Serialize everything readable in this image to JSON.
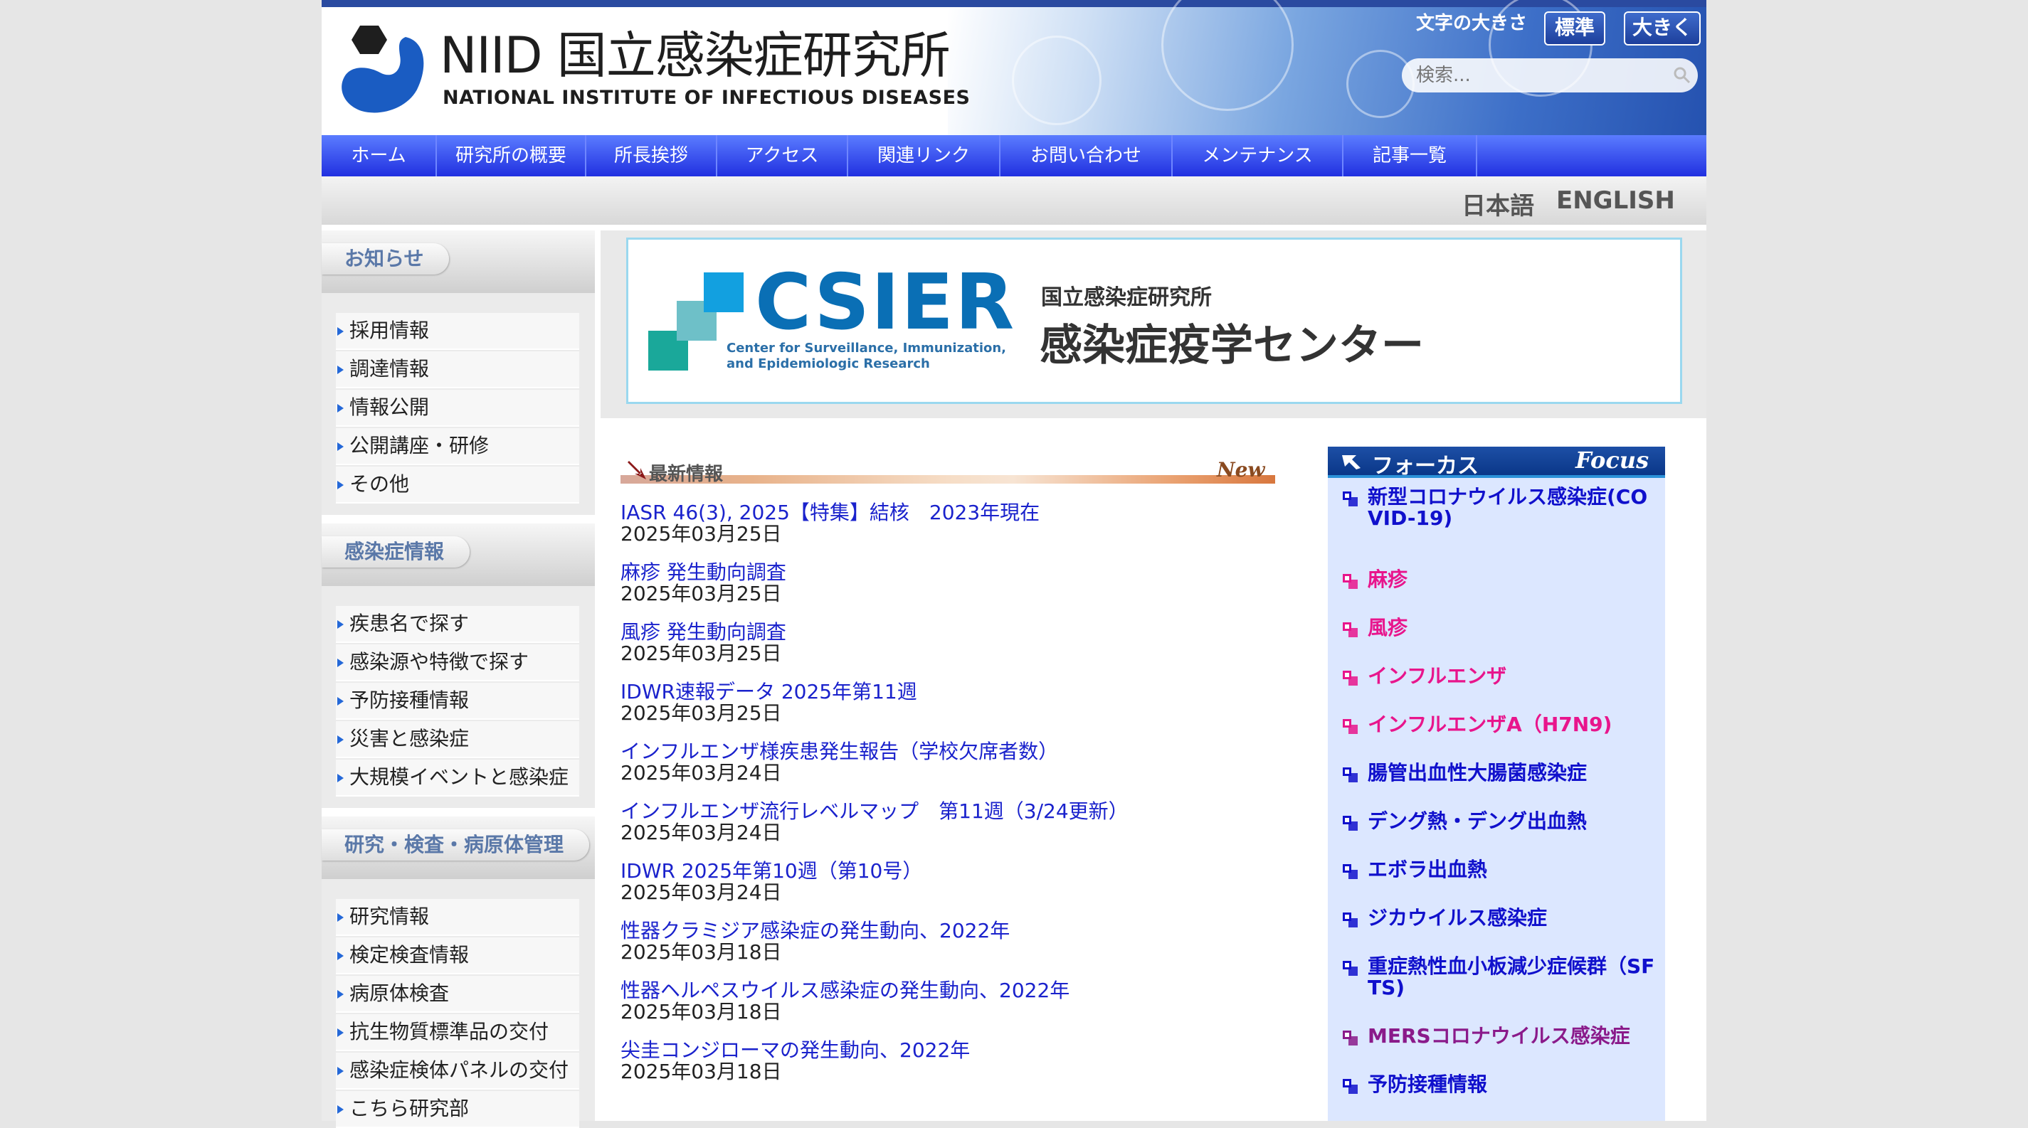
{
  "header": {
    "logo_jp": "NIID 国立感染症研究所",
    "logo_en": "NATIONAL INSTITUTE OF INFECTIOUS DISEASES",
    "font_size_label": "文字の大きさ",
    "font_size_standard": "標準",
    "font_size_large": "大きく",
    "search_placeholder": "検索..."
  },
  "nav": {
    "items": [
      "ホーム",
      "研究所の概要",
      "所長挨拶",
      "アクセス",
      "関連リンク",
      "お問い合わせ",
      "メンテナンス",
      "記事一覧"
    ]
  },
  "lang": {
    "jp": "日本語",
    "en": "ENGLISH"
  },
  "sidebar": {
    "sections": [
      {
        "title": "お知らせ",
        "items": [
          "採用情報",
          "調達情報",
          "情報公開",
          "公開講座・研修",
          "その他"
        ]
      },
      {
        "title": "感染症情報",
        "items": [
          "疾患名で探す",
          "感染源や特徴で探す",
          "予防接種情報",
          "災害と感染症",
          "大規模イベントと感染症"
        ]
      },
      {
        "title": "研究・検査・病原体管理",
        "items": [
          "研究情報",
          "検定検査情報",
          "病原体検査",
          "抗生物質標準品の交付",
          "感染症検体パネルの交付",
          "こちら研究部"
        ]
      }
    ]
  },
  "banner": {
    "title": "CSIER",
    "subtitle_line1": "Center for Surveillance, Immunization,",
    "subtitle_line2": "and Epidemiologic Research",
    "jp_small": "国立感染症研究所",
    "jp_large": "感染症疫学センター"
  },
  "news": {
    "title": "最新情報",
    "new_label": "New",
    "items": [
      {
        "title": "IASR 46(3), 2025【特集】結核　2023年現在",
        "date": "2025年03月25日"
      },
      {
        "title": "麻疹 発生動向調査",
        "date": "2025年03月25日"
      },
      {
        "title": "風疹 発生動向調査",
        "date": "2025年03月25日"
      },
      {
        "title": "IDWR速報データ 2025年第11週",
        "date": "2025年03月25日"
      },
      {
        "title": "インフルエンザ様疾患発生報告（学校欠席者数）",
        "date": "2025年03月24日"
      },
      {
        "title": "インフルエンザ流行レベルマップ　第11週（3/24更新）",
        "date": "2025年03月24日"
      },
      {
        "title": "IDWR 2025年第10週（第10号）",
        "date": "2025年03月24日"
      },
      {
        "title": "性器クラミジア感染症の発生動向、2022年",
        "date": "2025年03月18日"
      },
      {
        "title": "性器ヘルペスウイルス感染症の発生動向、2022年",
        "date": "2025年03月18日"
      },
      {
        "title": "尖圭コンジローマの発生動向、2022年",
        "date": "2025年03月18日"
      }
    ]
  },
  "focus": {
    "title_jp": "フォーカス",
    "title_en": "Focus",
    "colors": {
      "blue": "#1010cc",
      "pink": "#e8158c",
      "purple": "#8a1a8a"
    },
    "items": [
      {
        "label": "新型コロナウイルス感染症(COVID-19)",
        "color": "blue"
      },
      {
        "label": "麻疹",
        "color": "pink"
      },
      {
        "label": "風疹",
        "color": "pink"
      },
      {
        "label": "インフルエンザ",
        "color": "pink"
      },
      {
        "label": "インフルエンザA（H7N9)",
        "color": "pink"
      },
      {
        "label": "腸管出血性大腸菌感染症",
        "color": "blue"
      },
      {
        "label": "デング熱・デング出血熱",
        "color": "blue"
      },
      {
        "label": "エボラ出血熱",
        "color": "blue"
      },
      {
        "label": "ジカウイルス感染症",
        "color": "blue"
      },
      {
        "label": "重症熱性血小板減少症候群（SFTS)",
        "color": "blue"
      },
      {
        "label": "MERSコロナウイルス感染症",
        "color": "purple"
      },
      {
        "label": "予防接種情報",
        "color": "blue"
      }
    ]
  }
}
